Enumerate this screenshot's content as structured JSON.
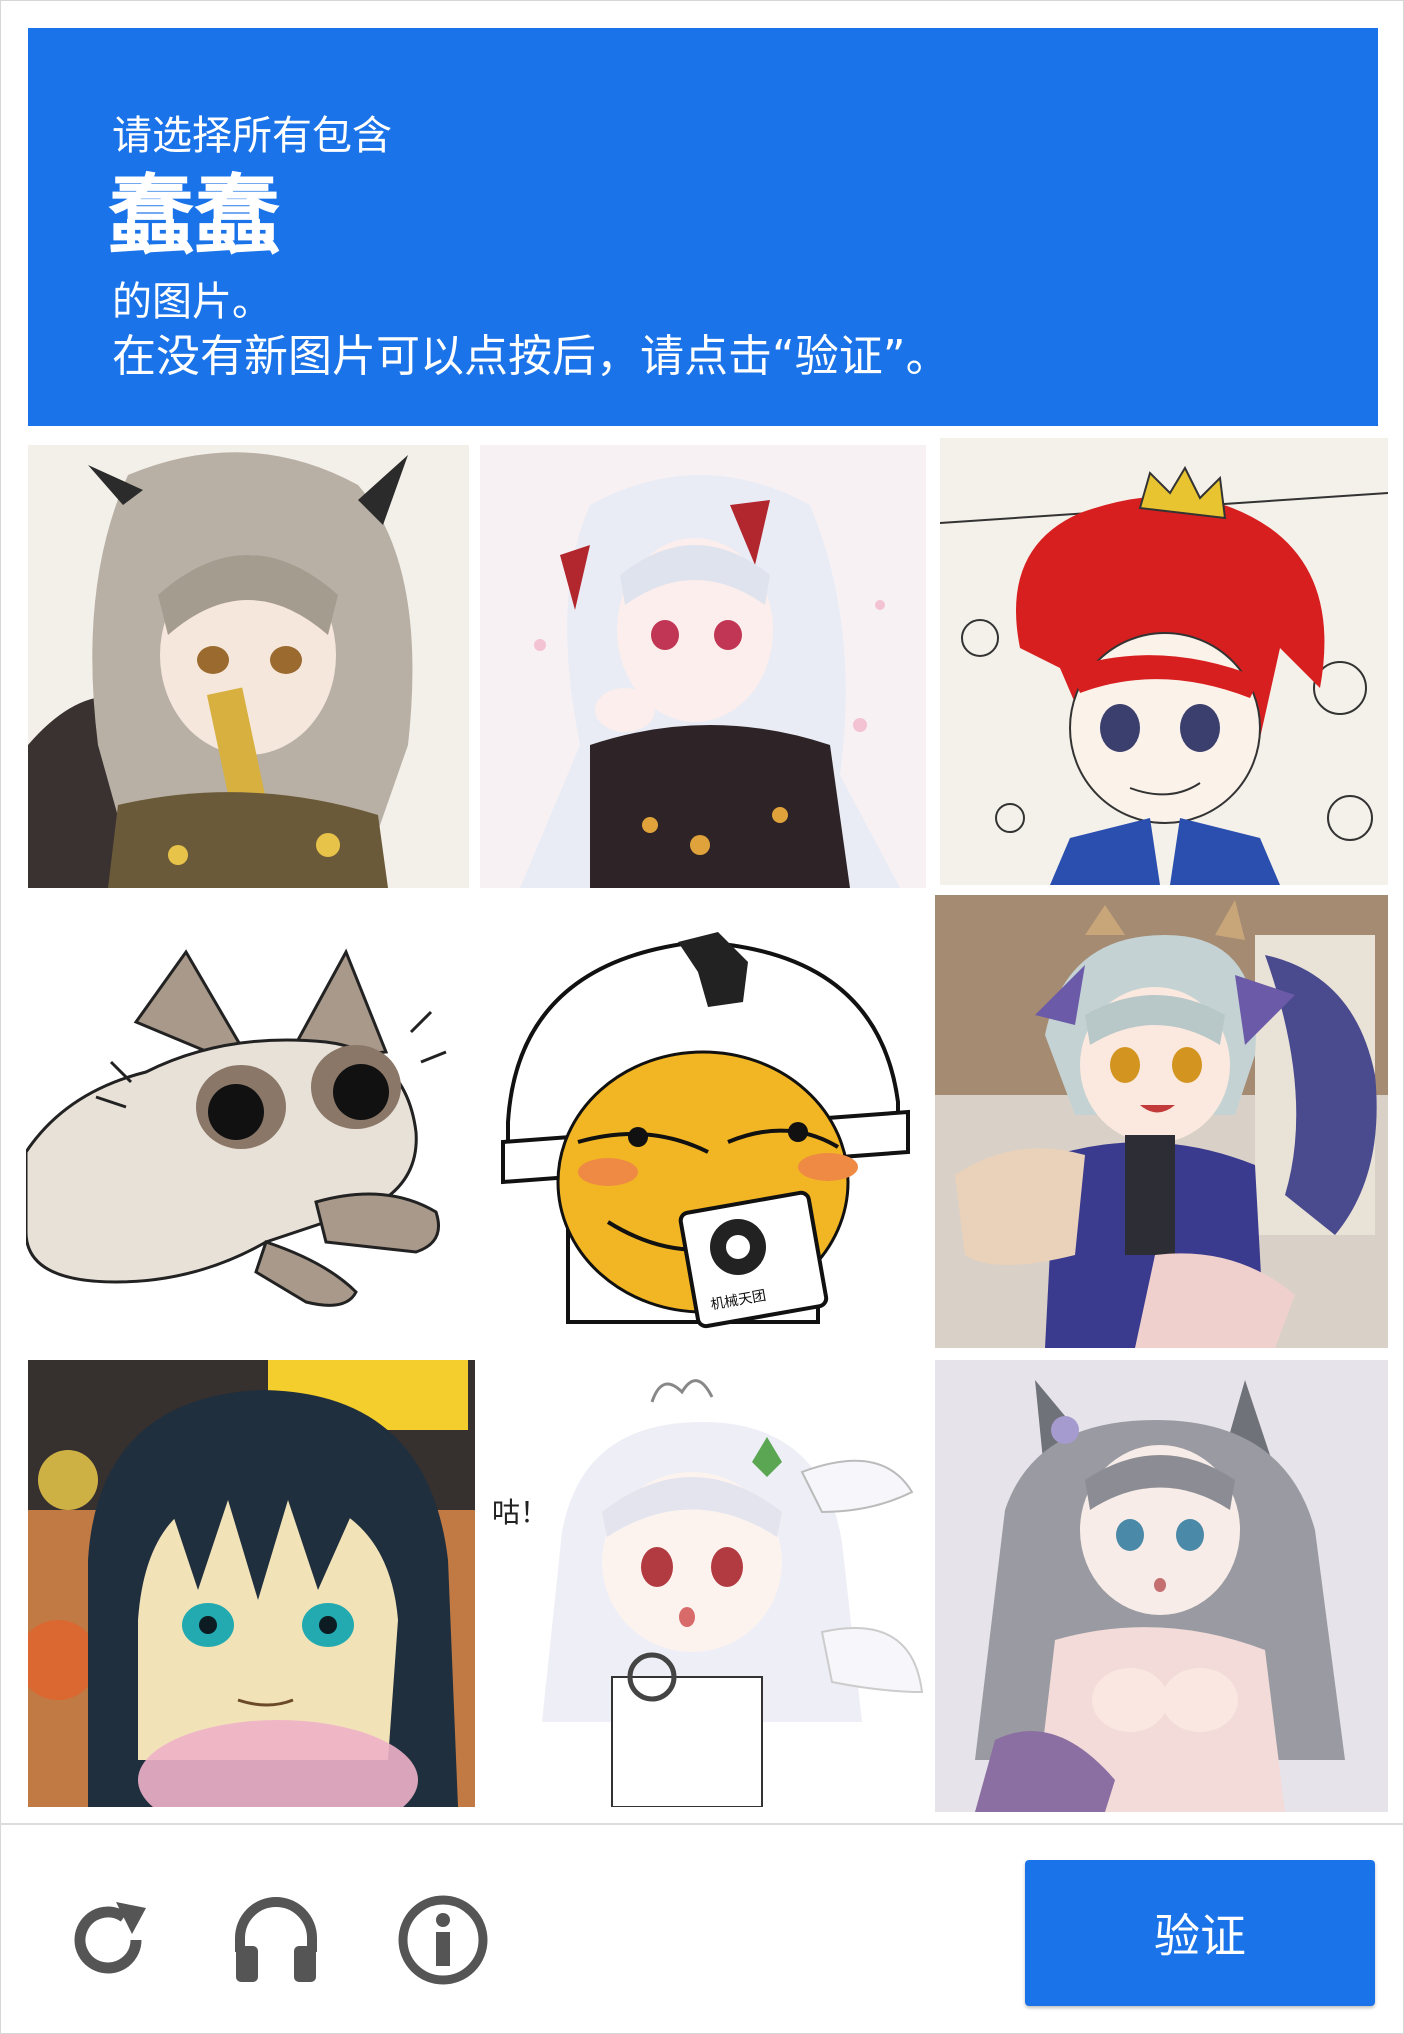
{
  "challenge": {
    "prompt_prefix": "请选择所有包含",
    "target": "蠢蠢",
    "suffix": "的图片。",
    "instruction": "在没有新图片可以点按后，请点击“验证”。"
  },
  "tiles": [
    {
      "id": 1,
      "icon": "anime-girl-silver-hair-horns-image"
    },
    {
      "id": 2,
      "icon": "anime-girl-white-hair-kimono-image"
    },
    {
      "id": 3,
      "icon": "sketch-red-hair-crown-image"
    },
    {
      "id": 4,
      "icon": "cartoon-siamese-cat-image"
    },
    {
      "id": 5,
      "icon": "emoji-helmet-mug-image"
    },
    {
      "id": 6,
      "icon": "anime-dragon-girl-image"
    },
    {
      "id": 7,
      "icon": "anime-boy-dark-hair-image"
    },
    {
      "id": 8,
      "icon": "chibi-white-hair-girl-image"
    },
    {
      "id": 9,
      "icon": "anime-cat-ear-girl-image"
    }
  ],
  "tile_texts": {
    "mug_label": "机械天团",
    "chibi_exclaim": "咕！"
  },
  "footer": {
    "reload_icon": "reload-icon",
    "audio_icon": "headphones-icon",
    "info_icon": "info-icon",
    "verify_label": "验证"
  },
  "colors": {
    "primary": "#1a73e8",
    "icon_gray": "#555555"
  }
}
